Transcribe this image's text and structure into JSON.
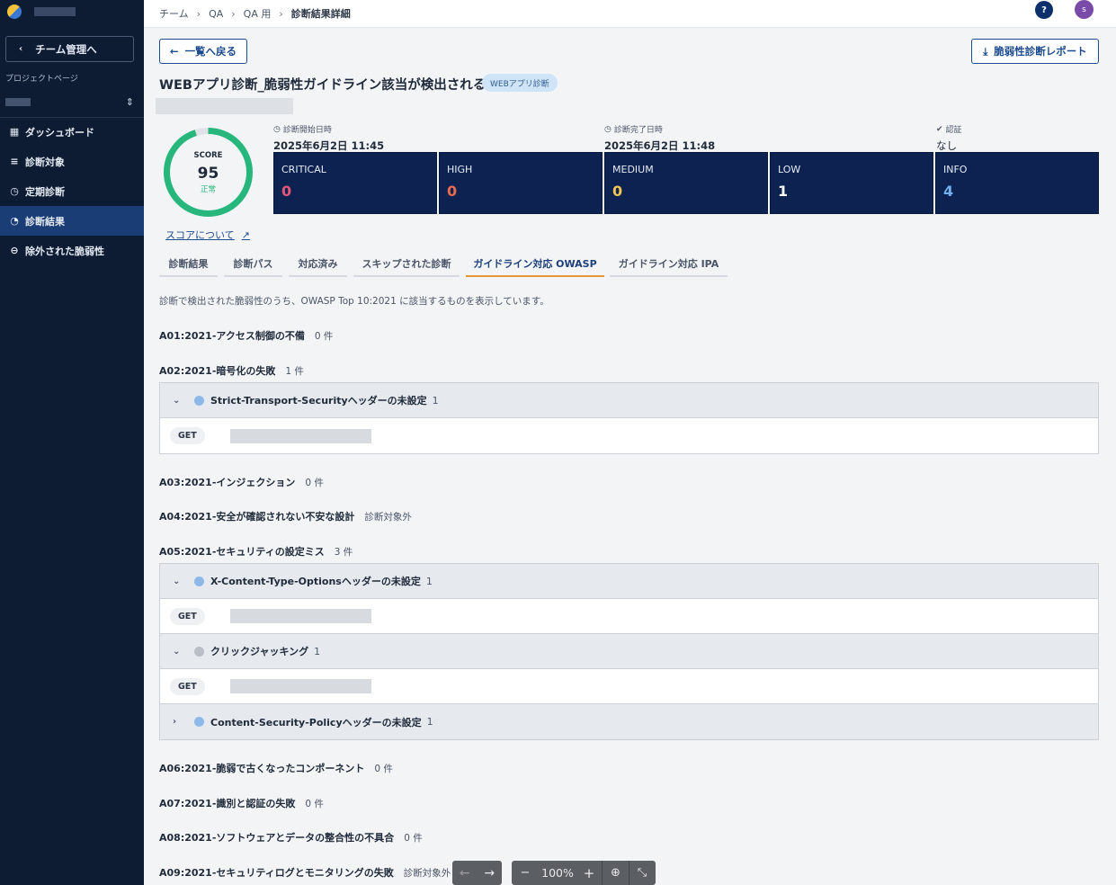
{
  "sidebar": {
    "back_label": "チーム管理へ",
    "project_label": "プロジェクトページ",
    "items": [
      {
        "label": "ダッシュボード",
        "icon": "dashboard-grid-icon"
      },
      {
        "label": "診断対象",
        "icon": "target-list-icon"
      },
      {
        "label": "定期診断",
        "icon": "clock-icon"
      },
      {
        "label": "診断結果",
        "icon": "pie-chart-icon",
        "active": true
      },
      {
        "label": "除外された脆弱性",
        "icon": "minus-circle-icon"
      }
    ]
  },
  "topbar": {
    "breadcrumb": [
      "チーム",
      "QA",
      "QA 用",
      "診断結果詳細"
    ],
    "help_label": "?",
    "avatar_initial": "s"
  },
  "header": {
    "back_button": "一覧へ戻る",
    "report_button": "脆弱性診断レポート",
    "title": "WEBアプリ診断_脆弱性ガイドライン該当が検出される",
    "type_badge": "WEBアプリ診断"
  },
  "score": {
    "label": "SCORE",
    "value": "95",
    "status": "正常",
    "fraction": 0.95,
    "link": "スコアについて"
  },
  "meta": {
    "start_label": "診断開始日時",
    "start_value": "2025年6月2日 11:45",
    "end_label": "診断完了日時",
    "end_value": "2025年6月2日 11:48",
    "auth_label": "認証",
    "auth_value": "なし"
  },
  "severity": [
    {
      "label": "CRITICAL",
      "count": "0",
      "color": "#e5577a"
    },
    {
      "label": "HIGH",
      "count": "0",
      "color": "#ea6a4f"
    },
    {
      "label": "MEDIUM",
      "count": "0",
      "color": "#f0c552"
    },
    {
      "label": "LOW",
      "count": "1",
      "color": "#ffffff"
    },
    {
      "label": "INFO",
      "count": "4",
      "color": "#6fb1ec"
    }
  ],
  "tabs": [
    {
      "label": "診断結果"
    },
    {
      "label": "診断パス"
    },
    {
      "label": "対応済み"
    },
    {
      "label": "スキップされた診断"
    },
    {
      "label": "ガイドライン対応 OWASP",
      "active": true
    },
    {
      "label": "ガイドライン対応 IPA"
    }
  ],
  "description": "診断で検出された脆弱性のうち、OWASP Top 10:2021 に該当するものを表示しています。",
  "categories": [
    {
      "name": "A01:2021-アクセス制御の不備",
      "count": "0 件"
    },
    {
      "name": "A02:2021-暗号化の失敗",
      "count": "1 件"
    },
    {
      "name": "A03:2021-インジェクション",
      "count": "0 件"
    },
    {
      "name": "A04:2021-安全が確認されない不安な設計",
      "count": "診断対象外"
    },
    {
      "name": "A05:2021-セキュリティの設定ミス",
      "count": "3 件"
    },
    {
      "name": "A06:2021-脆弱で古くなったコンポーネント",
      "count": "0 件"
    },
    {
      "name": "A07:2021-識別と認証の失敗",
      "count": "0 件"
    },
    {
      "name": "A08:2021-ソフトウェアとデータの整合性の不具合",
      "count": "0 件"
    },
    {
      "name": "A09:2021-セキュリティログとモニタリングの失敗",
      "count": "診断対象外"
    }
  ],
  "findings": {
    "a02": [
      {
        "title": "Strict-Transport-Securityヘッダーの未設定",
        "count": "1",
        "method": "GET"
      }
    ],
    "a05": [
      {
        "title": "X-Content-Type-Optionsヘッダーの未設定",
        "count": "1",
        "method": "GET"
      },
      {
        "title": "クリックジャッキング",
        "count": "1",
        "method": "GET"
      },
      {
        "title": "Content-Security-Policyヘッダーの未設定",
        "count": "1"
      }
    ]
  },
  "viewer": {
    "zoom": "100%"
  }
}
